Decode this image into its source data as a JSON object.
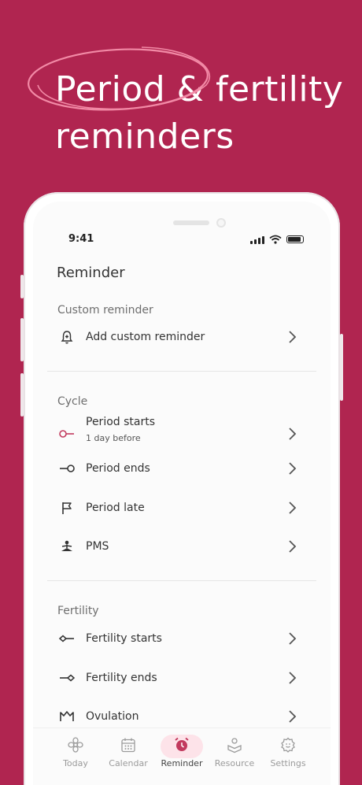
{
  "headline": {
    "line1": "Period & fertility",
    "line2": "reminders"
  },
  "status": {
    "time": "9:41"
  },
  "page_title": "Reminder",
  "sections": {
    "custom": {
      "label": "Custom reminder",
      "items": [
        {
          "label": "Add custom reminder",
          "icon": "bell-plus-icon"
        }
      ]
    },
    "cycle": {
      "label": "Cycle",
      "items": [
        {
          "label": "Period starts",
          "sub": "1 day before",
          "icon": "period-start-icon"
        },
        {
          "label": "Period ends",
          "icon": "period-end-icon"
        },
        {
          "label": "Period late",
          "icon": "flag-icon"
        },
        {
          "label": "PMS",
          "icon": "meditation-icon"
        }
      ]
    },
    "fertility": {
      "label": "Fertility",
      "items": [
        {
          "label": "Fertility starts",
          "icon": "fertility-start-icon"
        },
        {
          "label": "Fertility ends",
          "icon": "fertility-end-icon"
        },
        {
          "label": "Ovulation",
          "icon": "ovulation-icon"
        }
      ]
    }
  },
  "tabs": [
    {
      "label": "Today",
      "icon": "flower-icon"
    },
    {
      "label": "Calendar",
      "icon": "calendar-icon"
    },
    {
      "label": "Reminder",
      "icon": "alarm-clock-icon",
      "active": true
    },
    {
      "label": "Resource",
      "icon": "resource-icon"
    },
    {
      "label": "Settings",
      "icon": "settings-face-icon"
    }
  ],
  "colors": {
    "background": "#b02550",
    "accent": "#c23a5e",
    "pill": "#fde3e9",
    "scribble": "#f28aa6"
  }
}
